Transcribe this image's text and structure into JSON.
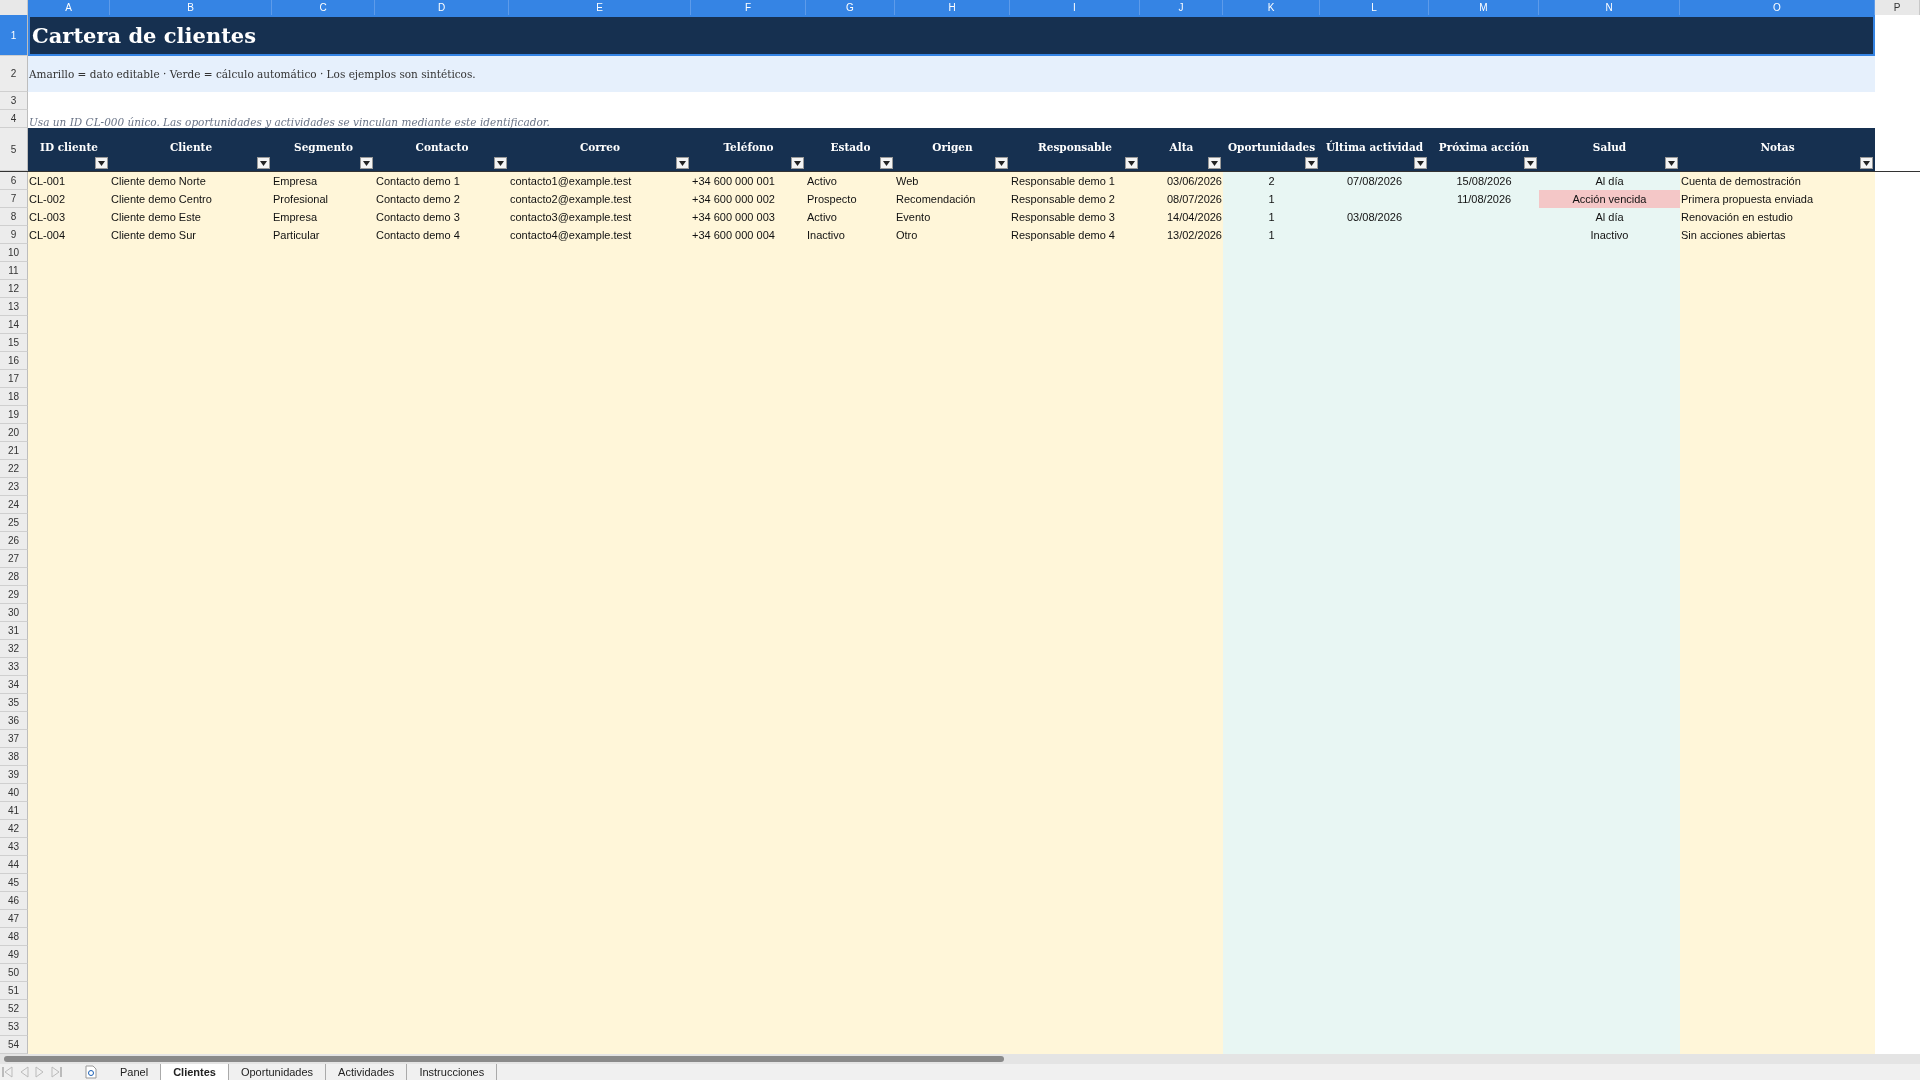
{
  "column_headers": [
    {
      "label": "A",
      "selected": true
    },
    {
      "label": "B",
      "selected": true
    },
    {
      "label": "C",
      "selected": true
    },
    {
      "label": "D",
      "selected": true
    },
    {
      "label": "E",
      "selected": true
    },
    {
      "label": "F",
      "selected": true
    },
    {
      "label": "G",
      "selected": true
    },
    {
      "label": "H",
      "selected": true
    },
    {
      "label": "I",
      "selected": true
    },
    {
      "label": "J",
      "selected": true
    },
    {
      "label": "K",
      "selected": true
    },
    {
      "label": "L",
      "selected": true
    },
    {
      "label": "M",
      "selected": true
    },
    {
      "label": "N",
      "selected": true
    },
    {
      "label": "O",
      "selected": true
    },
    {
      "label": "P",
      "selected": false
    }
  ],
  "row_headers": [
    {
      "label": "1",
      "selected": true
    },
    {
      "label": "2",
      "selected": false
    },
    {
      "label": "3",
      "selected": false
    },
    {
      "label": "4",
      "selected": false
    },
    {
      "label": "5",
      "selected": false
    },
    {
      "label": "6",
      "selected": false
    },
    {
      "label": "7",
      "selected": false
    },
    {
      "label": "8",
      "selected": false
    },
    {
      "label": "9",
      "selected": false
    },
    {
      "label": "10",
      "selected": false
    },
    {
      "label": "11",
      "selected": false
    },
    {
      "label": "12",
      "selected": false
    },
    {
      "label": "13",
      "selected": false
    },
    {
      "label": "14",
      "selected": false
    },
    {
      "label": "15",
      "selected": false
    },
    {
      "label": "16",
      "selected": false
    },
    {
      "label": "17",
      "selected": false
    },
    {
      "label": "18",
      "selected": false
    },
    {
      "label": "19",
      "selected": false
    },
    {
      "label": "20",
      "selected": false
    },
    {
      "label": "21",
      "selected": false
    },
    {
      "label": "22",
      "selected": false
    },
    {
      "label": "23",
      "selected": false
    },
    {
      "label": "24",
      "selected": false
    },
    {
      "label": "25",
      "selected": false
    },
    {
      "label": "26",
      "selected": false
    },
    {
      "label": "27",
      "selected": false
    },
    {
      "label": "28",
      "selected": false
    },
    {
      "label": "29",
      "selected": false
    },
    {
      "label": "30",
      "selected": false
    },
    {
      "label": "31",
      "selected": false
    },
    {
      "label": "32",
      "selected": false
    },
    {
      "label": "33",
      "selected": false
    },
    {
      "label": "34",
      "selected": false
    },
    {
      "label": "35",
      "selected": false
    },
    {
      "label": "36",
      "selected": false
    },
    {
      "label": "37",
      "selected": false
    },
    {
      "label": "38",
      "selected": false
    },
    {
      "label": "39",
      "selected": false
    },
    {
      "label": "40",
      "selected": false
    },
    {
      "label": "41",
      "selected": false
    },
    {
      "label": "42",
      "selected": false
    },
    {
      "label": "43",
      "selected": false
    },
    {
      "label": "44",
      "selected": false
    },
    {
      "label": "45",
      "selected": false
    },
    {
      "label": "46",
      "selected": false
    },
    {
      "label": "47",
      "selected": false
    },
    {
      "label": "48",
      "selected": false
    },
    {
      "label": "49",
      "selected": false
    },
    {
      "label": "50",
      "selected": false
    },
    {
      "label": "51",
      "selected": false
    },
    {
      "label": "52",
      "selected": false
    },
    {
      "label": "53",
      "selected": false
    },
    {
      "label": "54",
      "selected": false
    }
  ],
  "title": "Cartera de clientes",
  "legend": "Amarillo = dato editable · Verde = cálculo automático · Los ejemplos son sintéticos.",
  "note": "Usa un ID CL-000 único. Las oportunidades y actividades se vinculan mediante este identificador.",
  "table": {
    "columns": [
      {
        "label": "ID cliente",
        "kind": "input"
      },
      {
        "label": "Cliente",
        "kind": "input"
      },
      {
        "label": "Segmento",
        "kind": "input"
      },
      {
        "label": "Contacto",
        "kind": "input"
      },
      {
        "label": "Correo",
        "kind": "input"
      },
      {
        "label": "Teléfono",
        "kind": "input"
      },
      {
        "label": "Estado",
        "kind": "input"
      },
      {
        "label": "Origen",
        "kind": "input"
      },
      {
        "label": "Responsable",
        "kind": "input"
      },
      {
        "label": "Alta",
        "kind": "inputdate"
      },
      {
        "label": "Oportunidades",
        "kind": "calc"
      },
      {
        "label": "Última actividad",
        "kind": "calc"
      },
      {
        "label": "Próxima acción",
        "kind": "calc"
      },
      {
        "label": "Salud",
        "kind": "status"
      },
      {
        "label": "Notas",
        "kind": "input"
      }
    ],
    "rows": [
      {
        "cells": [
          "CL-001",
          "Cliente demo Norte",
          "Empresa",
          "Contacto demo 1",
          "contacto1@example.test",
          "+34 600 000 001",
          "Activo",
          "Web",
          "Responsable demo 1",
          "03/06/2026",
          "2",
          "07/08/2026",
          "15/08/2026",
          "Al día",
          "Cuenta de demostración"
        ],
        "overdue": false
      },
      {
        "cells": [
          "CL-002",
          "Cliente demo Centro",
          "Profesional",
          "Contacto demo 2",
          "contacto2@example.test",
          "+34 600 000 002",
          "Prospecto",
          "Recomendación",
          "Responsable demo 2",
          "08/07/2026",
          "1",
          "",
          "11/08/2026",
          "Acción vencida",
          "Primera propuesta enviada"
        ],
        "overdue": true
      },
      {
        "cells": [
          "CL-003",
          "Cliente demo Este",
          "Empresa",
          "Contacto demo 3",
          "contacto3@example.test",
          "+34 600 000 003",
          "Activo",
          "Evento",
          "Responsable demo 3",
          "14/04/2026",
          "1",
          "03/08/2026",
          "",
          "Al día",
          "Renovación en estudio"
        ],
        "overdue": false
      },
      {
        "cells": [
          "CL-004",
          "Cliente demo Sur",
          "Particular",
          "Contacto demo 4",
          "contacto4@example.test",
          "+34 600 000 004",
          "Inactivo",
          "Otro",
          "Responsable demo 4",
          "13/02/2026",
          "1",
          "",
          "",
          "Inactivo",
          "Sin acciones abiertas"
        ],
        "overdue": false
      }
    ]
  },
  "sheet_tabs": [
    {
      "label": "Panel",
      "selected": false
    },
    {
      "label": "Clientes",
      "selected": true
    },
    {
      "label": "Oportunidades",
      "selected": false
    },
    {
      "label": "Actividades",
      "selected": false
    },
    {
      "label": "Instrucciones",
      "selected": false
    }
  ]
}
